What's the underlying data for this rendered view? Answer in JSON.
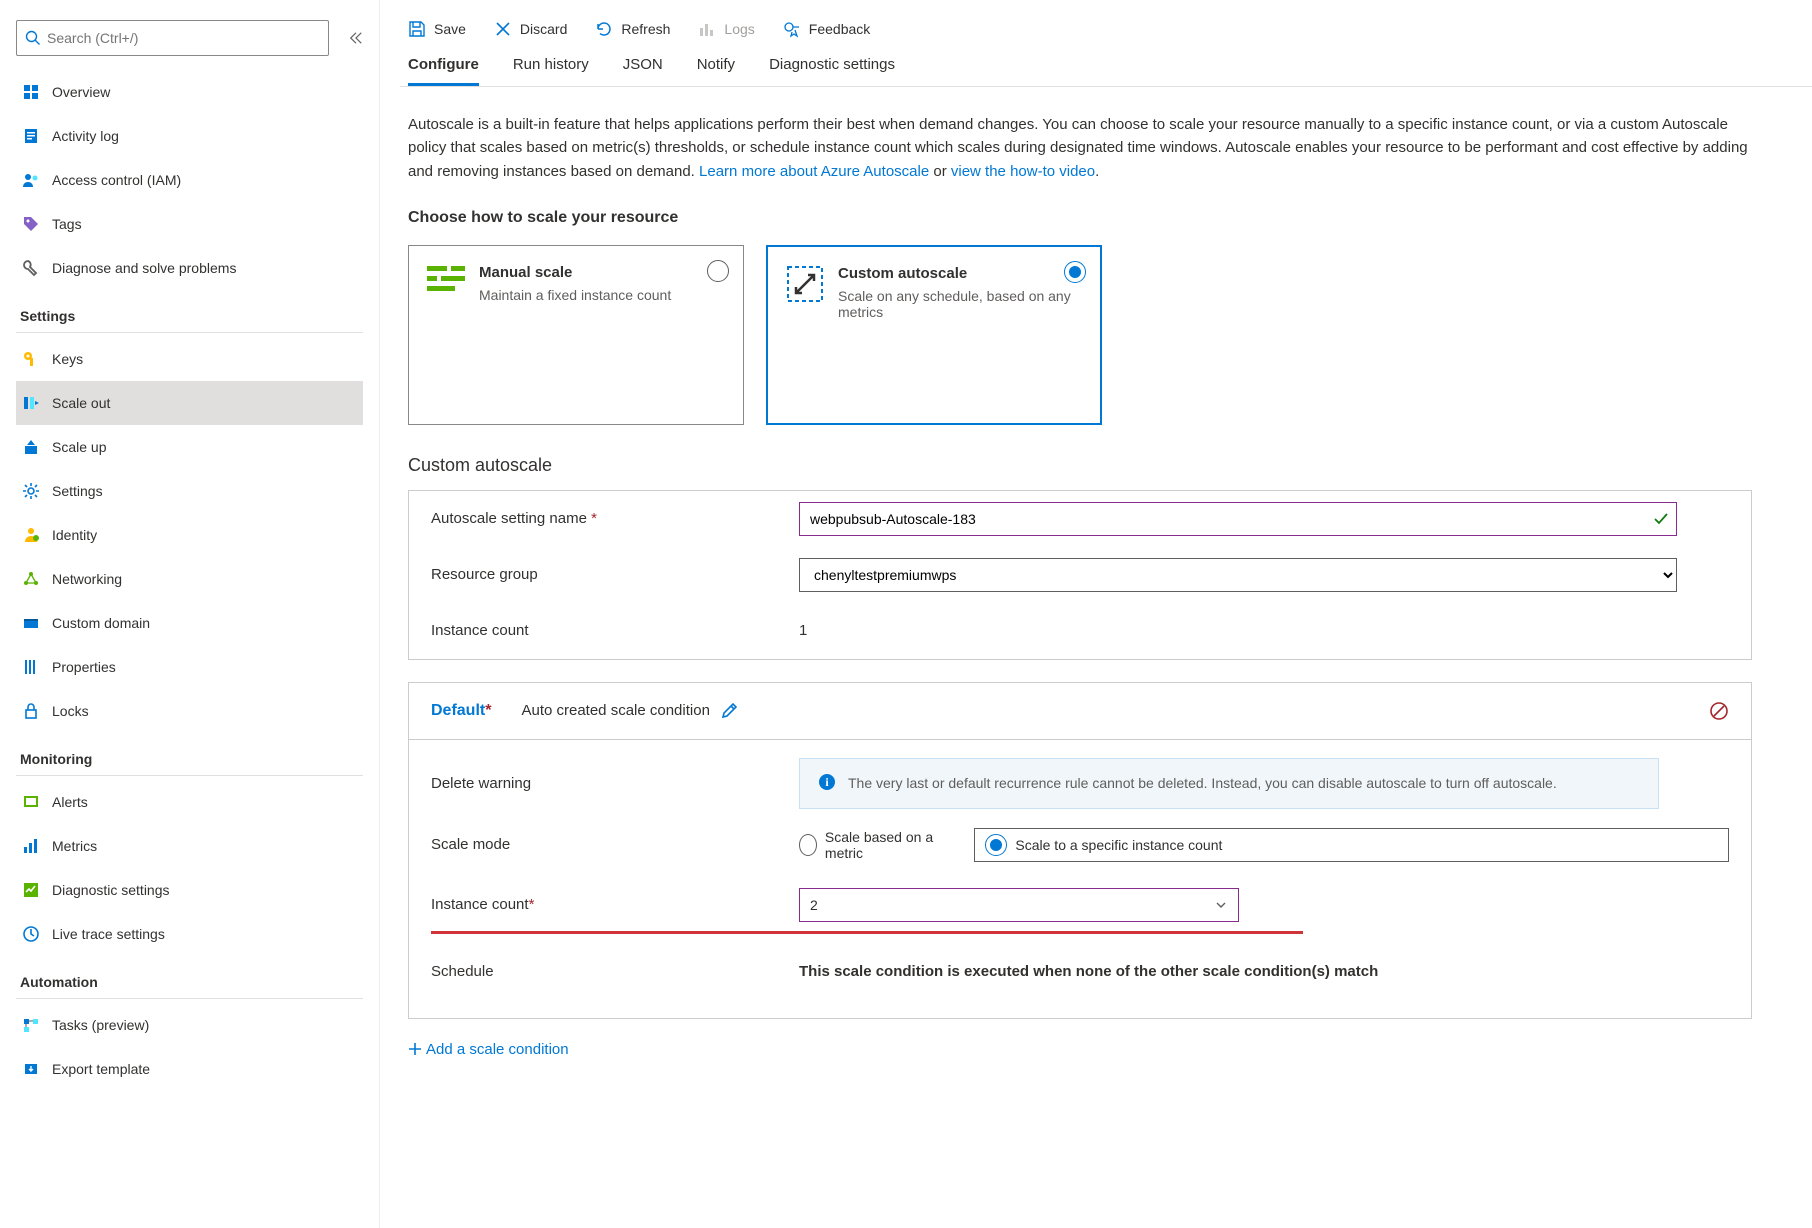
{
  "search": {
    "placeholder": "Search (Ctrl+/)"
  },
  "sidebar": {
    "top": [
      {
        "label": "Overview"
      },
      {
        "label": "Activity log"
      },
      {
        "label": "Access control (IAM)"
      },
      {
        "label": "Tags"
      },
      {
        "label": "Diagnose and solve problems"
      }
    ],
    "sections": [
      {
        "header": "Settings",
        "items": [
          {
            "label": "Keys"
          },
          {
            "label": "Scale out",
            "selected": true
          },
          {
            "label": "Scale up"
          },
          {
            "label": "Settings"
          },
          {
            "label": "Identity"
          },
          {
            "label": "Networking"
          },
          {
            "label": "Custom domain"
          },
          {
            "label": "Properties"
          },
          {
            "label": "Locks"
          }
        ]
      },
      {
        "header": "Monitoring",
        "items": [
          {
            "label": "Alerts"
          },
          {
            "label": "Metrics"
          },
          {
            "label": "Diagnostic settings"
          },
          {
            "label": "Live trace settings"
          }
        ]
      },
      {
        "header": "Automation",
        "items": [
          {
            "label": "Tasks (preview)"
          },
          {
            "label": "Export template"
          }
        ]
      }
    ]
  },
  "toolbar": {
    "save": "Save",
    "discard": "Discard",
    "refresh": "Refresh",
    "logs": "Logs",
    "feedback": "Feedback"
  },
  "tabs": [
    "Configure",
    "Run history",
    "JSON",
    "Notify",
    "Diagnostic settings"
  ],
  "desc": {
    "body": "Autoscale is a built-in feature that helps applications perform their best when demand changes. You can choose to scale your resource manually to a specific instance count, or via a custom Autoscale policy that scales based on metric(s) thresholds, or schedule instance count which scales during designated time windows. Autoscale enables your resource to be performant and cost effective by adding and removing instances based on demand. ",
    "link1": "Learn more about Azure Autoscale",
    "or": " or ",
    "link2": "view the how-to video"
  },
  "choose": "Choose how to scale your resource",
  "cards": {
    "manual": {
      "title": "Manual scale",
      "sub": "Maintain a fixed instance count"
    },
    "custom": {
      "title": "Custom autoscale",
      "sub": "Scale on any schedule, based on any metrics"
    }
  },
  "sect": "Custom autoscale",
  "form": {
    "name_label": "Autoscale setting name",
    "name_value": "webpubsub-Autoscale-183",
    "rg_label": "Resource group",
    "rg_value": "chenyltestpremiumwps",
    "ic_label": "Instance count",
    "ic_value": "1"
  },
  "default_panel": {
    "header": "Default",
    "sub": "Auto created scale condition",
    "delete_label": "Delete warning",
    "delete_info": "The very last or default recurrence rule cannot be deleted. Instead, you can disable autoscale to turn off autoscale.",
    "mode_label": "Scale mode",
    "mode_metric": "Scale based on a metric",
    "mode_specific": "Scale to a specific instance count",
    "ic_label": "Instance count",
    "ic_value": "2",
    "schedule_label": "Schedule",
    "schedule_note": "This scale condition is executed when none of the other scale condition(s) match"
  },
  "add_cond": "Add a scale condition"
}
